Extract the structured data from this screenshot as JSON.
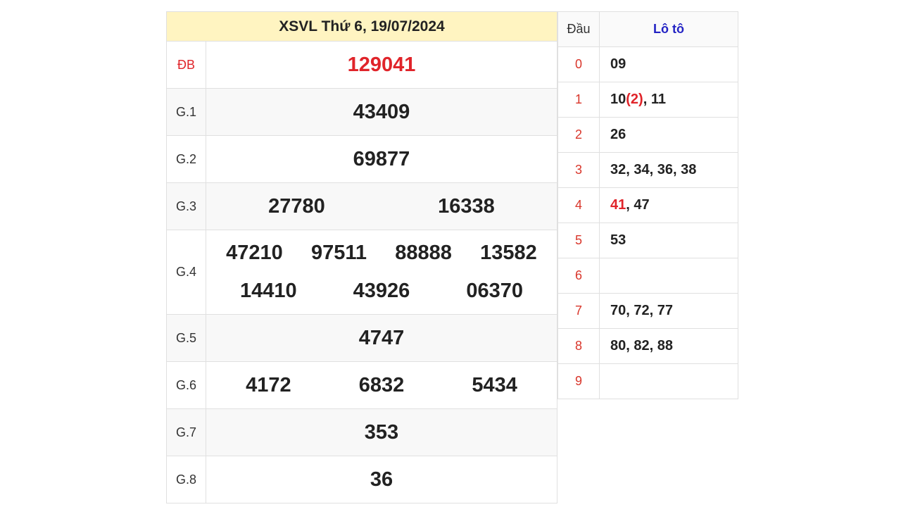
{
  "results": {
    "title": "XSVL Thứ 6, 19/07/2024",
    "prizes": [
      {
        "label": "ĐB",
        "numbers": [
          "129041"
        ],
        "special": true
      },
      {
        "label": "G.1",
        "numbers": [
          "43409"
        ]
      },
      {
        "label": "G.2",
        "numbers": [
          "69877"
        ]
      },
      {
        "label": "G.3",
        "numbers": [
          "27780",
          "16338"
        ]
      },
      {
        "label": "G.4",
        "numbers": [
          "47210",
          "97511",
          "88888",
          "13582",
          "14410",
          "43926",
          "06370"
        ]
      },
      {
        "label": "G.5",
        "numbers": [
          "4747"
        ]
      },
      {
        "label": "G.6",
        "numbers": [
          "4172",
          "6832",
          "5434"
        ]
      },
      {
        "label": "G.7",
        "numbers": [
          "353"
        ]
      },
      {
        "label": "G.8",
        "numbers": [
          "36"
        ]
      }
    ]
  },
  "loto": {
    "header_dau": "Đầu",
    "header_loto": "Lô tô",
    "rows": [
      {
        "dau": "0",
        "parts": [
          {
            "t": "09"
          }
        ]
      },
      {
        "dau": "1",
        "parts": [
          {
            "t": "10"
          },
          {
            "t": "(2)",
            "red": true
          },
          {
            "t": ", 11"
          }
        ]
      },
      {
        "dau": "2",
        "parts": [
          {
            "t": "26"
          }
        ]
      },
      {
        "dau": "3",
        "parts": [
          {
            "t": "32, 34, 36, 38"
          }
        ]
      },
      {
        "dau": "4",
        "parts": [
          {
            "t": "41",
            "red": true
          },
          {
            "t": ", 47"
          }
        ]
      },
      {
        "dau": "5",
        "parts": [
          {
            "t": "53"
          }
        ]
      },
      {
        "dau": "6",
        "parts": []
      },
      {
        "dau": "7",
        "parts": [
          {
            "t": "70, 72, 77"
          }
        ]
      },
      {
        "dau": "8",
        "parts": [
          {
            "t": "80, 82, 88"
          }
        ]
      },
      {
        "dau": "9",
        "parts": []
      }
    ]
  },
  "colors": {
    "header_bg": "#fff4c1",
    "special_red": "#e0242a",
    "dau_red": "#d9362b",
    "loto_header_blue": "#2323c4"
  }
}
